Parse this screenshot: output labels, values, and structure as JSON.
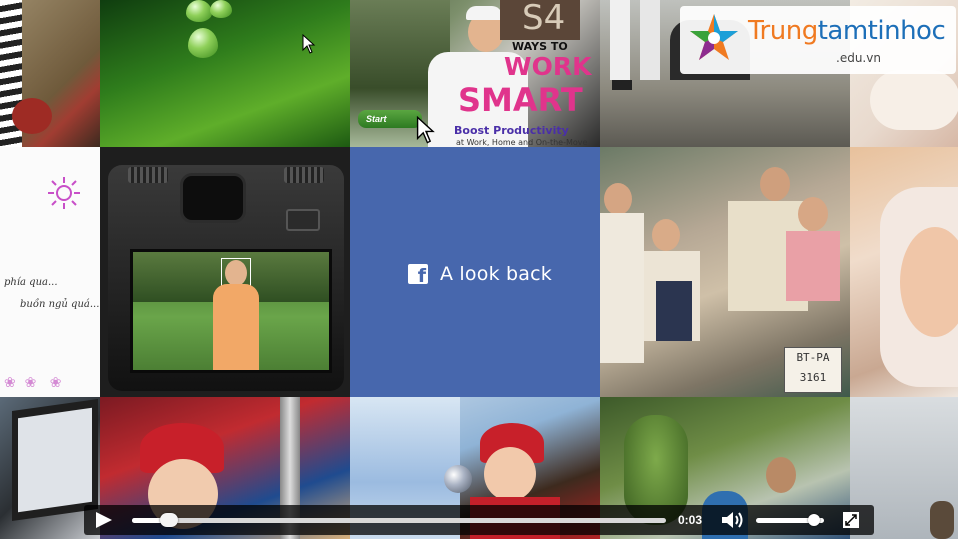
{
  "center": {
    "fb_glyph": "f",
    "title": "A look back"
  },
  "book": {
    "line1": "WAYS TO",
    "line2": "WORK",
    "line3": "SMART",
    "line4": "Boost Productivity",
    "line5": "at Work, Home and On-the-Move",
    "start_label": "Start",
    "sign": "S4"
  },
  "watermark": {
    "name_part1": "Trung",
    "name_part2": "tamtinhoc",
    "domain": ".edu.vn"
  },
  "handwriting": {
    "line1": "phía qua...",
    "line2": "buồn ngủ quá..."
  },
  "plate": {
    "line1": "BT-PA",
    "line2": "3161"
  },
  "player": {
    "time": "0:03",
    "progress_fraction": 0.07,
    "volume_fraction": 0.85
  },
  "colors": {
    "facebook_blue": "#4767ad",
    "watermark_orange": "#f07a21",
    "watermark_blue": "#1d6fb8"
  }
}
